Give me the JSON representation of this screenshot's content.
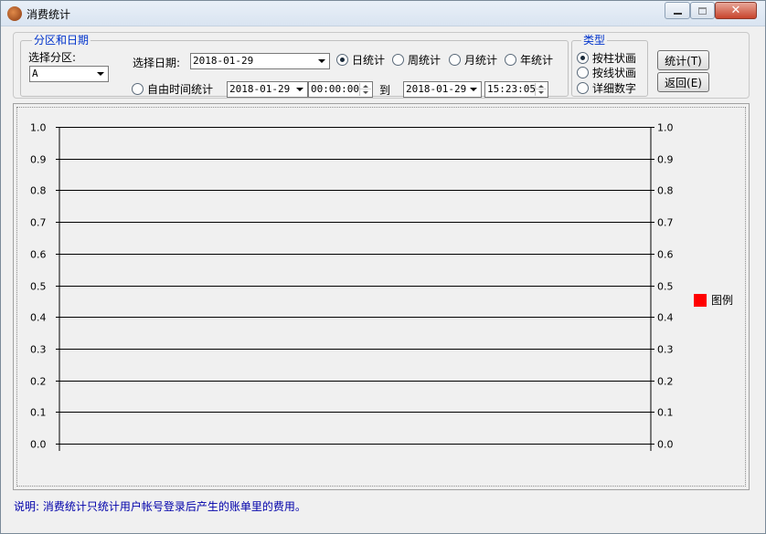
{
  "window": {
    "title": "消费统计"
  },
  "date_group": {
    "legend": "分区和日期",
    "partition_label": "选择分区:",
    "partition_value": "A",
    "select_date_label": "选择日期:",
    "select_date_value": "2018-01-29",
    "period_options": [
      {
        "label": "日统计",
        "selected": true
      },
      {
        "label": "周统计",
        "selected": false
      },
      {
        "label": "月统计",
        "selected": false
      },
      {
        "label": "年统计",
        "selected": false
      }
    ],
    "free_time_label": "自由时间统计",
    "free_time_selected": false,
    "from_date": "2018-01-29",
    "from_time": "00:00:00",
    "to_label": "到",
    "to_date": "2018-01-29",
    "to_time": "15:23:05"
  },
  "type_group": {
    "legend": "类型",
    "options": [
      {
        "label": "按柱状画",
        "selected": true
      },
      {
        "label": "按线状画",
        "selected": false
      },
      {
        "label": "详细数字",
        "selected": false
      }
    ]
  },
  "buttons": {
    "stats_label": "统计(T)",
    "back_label": "返回(E)"
  },
  "chart_data": {
    "type": "bar",
    "categories": [],
    "series": [],
    "ylim": [
      0.0,
      1.0
    ],
    "y_ticks": [
      "0.0",
      "0.1",
      "0.2",
      "0.3",
      "0.4",
      "0.5",
      "0.6",
      "0.7",
      "0.8",
      "0.9",
      "1.0"
    ],
    "grid": true,
    "legend": {
      "placement": "right",
      "label": "图例",
      "color": "#ff0000"
    }
  },
  "footer": {
    "note": "说明: 消费统计只统计用户帐号登录后产生的账单里的费用。"
  }
}
